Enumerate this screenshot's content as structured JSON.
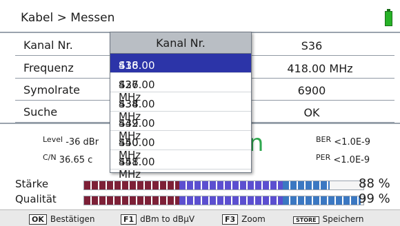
{
  "header": {
    "breadcrumb": "Kabel > Messen"
  },
  "settings": [
    {
      "label": "Kanal Nr.",
      "value": "S36"
    },
    {
      "label": "Frequenz",
      "value": "418.00 MHz"
    },
    {
      "label": "Symolrate",
      "value": "6900"
    },
    {
      "label": "Suche",
      "value": "OK"
    }
  ],
  "measurements": {
    "level_label": "Level",
    "level_value": "-36 dBr",
    "cn_label": "C/N",
    "cn_value": "36.65 c",
    "lock_text": "en",
    "ber_label": "BER",
    "ber_value": "<1.0E-9",
    "per_label": "PER",
    "per_value": "<1.0E-9"
  },
  "bars": {
    "strength": {
      "label": "Stärke",
      "percent_text": "88 %",
      "level": 0.88
    },
    "quality": {
      "label": "Qualität",
      "percent_text": "99 %",
      "level": 0.99
    }
  },
  "popup": {
    "title": "Kanal Nr.",
    "items": [
      {
        "channel": "S36",
        "freq": "418.00 MHz",
        "selected": true
      },
      {
        "channel": "S37",
        "freq": "426.00 MHz",
        "selected": false
      },
      {
        "channel": "S38",
        "freq": "434.00 MHz",
        "selected": false
      },
      {
        "channel": "S39",
        "freq": "442.00 MHz",
        "selected": false
      },
      {
        "channel": "S40",
        "freq": "450.00 MHz",
        "selected": false
      },
      {
        "channel": "S41",
        "freq": "458.00 MHz",
        "selected": false
      }
    ]
  },
  "footer": {
    "ok_key": "OK",
    "ok_label": "Bestätigen",
    "f1_key": "F1",
    "f1_label": "dBm to dBµV",
    "f3_key": "F3",
    "f3_label": "Zoom",
    "store_key": "STORE",
    "store_label": "Speichern"
  },
  "colors": {
    "selection": "#2c34a8",
    "lock_green": "#2fa84f",
    "bar_red": "#7d2037",
    "bar_purple": "#5b4fd0",
    "bar_blue": "#3b78c2"
  }
}
